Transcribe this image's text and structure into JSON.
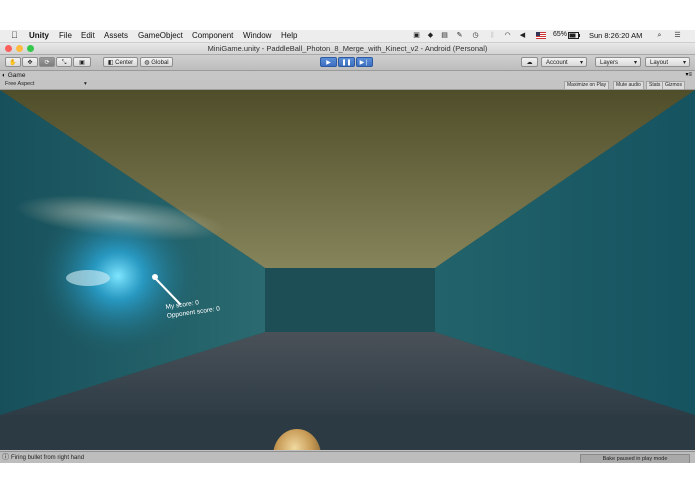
{
  "menubar": {
    "apple": "",
    "app_name": "Unity",
    "items": [
      "File",
      "Edit",
      "Assets",
      "GameObject",
      "Component",
      "Window",
      "Help"
    ],
    "battery": "65%",
    "clock": "Sun 8:26:20 AM"
  },
  "window": {
    "title": "MiniGame.unity - PaddleBall_Photon_8_Merge_with_Kinect_v2 - Android (Personal)"
  },
  "toolbar": {
    "pivot_label": "Center",
    "space_label": "Global",
    "account_label": "Account",
    "layers_label": "Layers",
    "layout_label": "Layout"
  },
  "game_view": {
    "tab_label": "Game",
    "aspect_label": "Free Aspect",
    "maximize_label": "Maximize on Play",
    "mute_label": "Mute audio",
    "stats_label": "Stats",
    "gizmos_label": "Gizmos"
  },
  "hud": {
    "my_score": "My score: 0",
    "opponent_score": "Opponent score: 0"
  },
  "status": {
    "message": "Firing bullet from right hand",
    "bake": "Bake paused in play mode"
  },
  "colors": {
    "play_blue": "#3d6fc1",
    "wall_teal": "#1f5d66",
    "ceiling": "#6b6a3c",
    "floor": "#3b4852"
  }
}
